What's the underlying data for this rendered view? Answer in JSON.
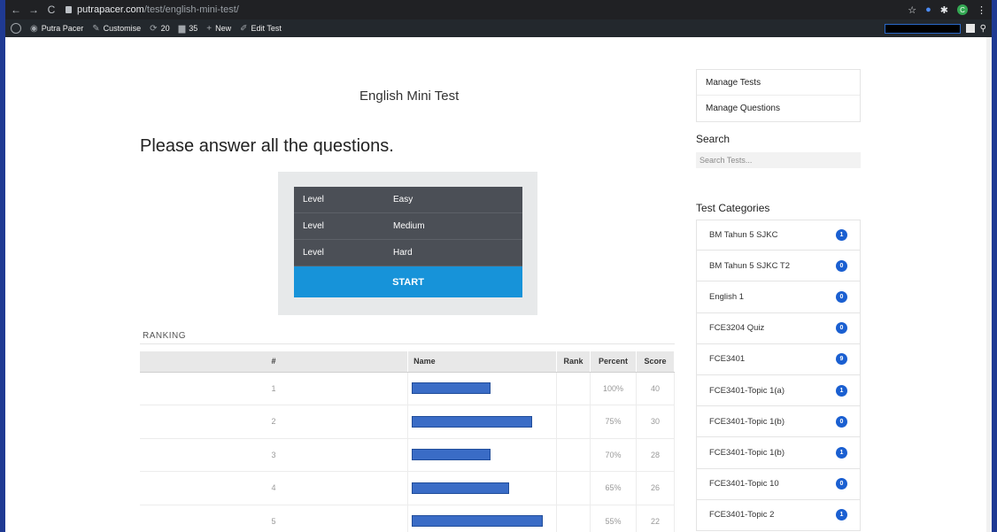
{
  "browser": {
    "url_host": "putrapacer.com",
    "url_path": "/test/english-mini-test/",
    "avatar_letter": "C"
  },
  "admin_bar": {
    "site_name": "Putra Pacer",
    "customise": "Customise",
    "updates_count": "20",
    "comments_count": "35",
    "new_label": "New",
    "edit_label": "Edit Test"
  },
  "test": {
    "title": "English Mini Test",
    "headline": "Please answer all the questions.",
    "levels": [
      {
        "label": "Level",
        "value": "Easy"
      },
      {
        "label": "Level",
        "value": "Medium"
      },
      {
        "label": "Level",
        "value": "Hard"
      }
    ],
    "start_label": "START"
  },
  "ranking": {
    "label": "RANKING",
    "columns": [
      "#",
      "Name",
      "Rank",
      "Percent",
      "Score"
    ],
    "rows": [
      {
        "num": "1",
        "percent": "100%",
        "score": "40"
      },
      {
        "num": "2",
        "percent": "75%",
        "score": "30"
      },
      {
        "num": "3",
        "percent": "70%",
        "score": "28"
      },
      {
        "num": "4",
        "percent": "65%",
        "score": "26"
      },
      {
        "num": "5",
        "percent": "55%",
        "score": "22"
      }
    ]
  },
  "sidebar": {
    "manage": [
      "Manage Tests",
      "Manage Questions"
    ],
    "search_title": "Search",
    "search_placeholder": "Search Tests...",
    "categories_title": "Test Categories",
    "categories": [
      {
        "label": "BM Tahun 5 SJKC",
        "count": "1"
      },
      {
        "label": "BM Tahun 5 SJKC T2",
        "count": "0"
      },
      {
        "label": "English 1",
        "count": "0"
      },
      {
        "label": "FCE3204 Quiz",
        "count": "0"
      },
      {
        "label": "FCE3401",
        "count": "9"
      },
      {
        "label": "FCE3401-Topic 1(a)",
        "count": "1"
      },
      {
        "label": "FCE3401-Topic 1(b)",
        "count": "0"
      },
      {
        "label": "FCE3401-Topic 1(b)",
        "count": "1"
      },
      {
        "label": "FCE3401-Topic 10",
        "count": "0"
      },
      {
        "label": "FCE3401-Topic 2",
        "count": "1"
      }
    ]
  },
  "colors": {
    "start_button": "#1793d9",
    "level_row": "#4b4f56",
    "badge": "#1a5fd1",
    "admin_bar": "#23282d"
  }
}
